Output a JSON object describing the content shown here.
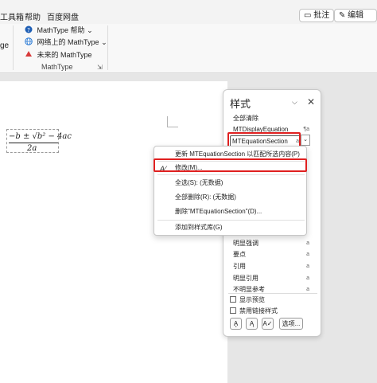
{
  "menubar": {
    "items": [
      "工具箱",
      "帮助",
      "百度网盘"
    ],
    "comment_button": "批注",
    "edit_button": "编辑"
  },
  "ribbon": {
    "cut_text": "ge",
    "mathtype_items": [
      "MathType 帮助",
      "网络上的 MathType",
      "未来的 MathType"
    ],
    "group_label": "MathType",
    "icon_colors": {
      "help": "#1f5fb5",
      "web": "#2b7bd6",
      "future": "#d83b3b"
    }
  },
  "document": {
    "equation_numerator": "−b ± √b² − 4ac",
    "equation_denominator": "2a"
  },
  "styles_pane": {
    "title": "样式",
    "entries": {
      "clear_all": "全部清除",
      "display_eq": "MTDisplayEquation",
      "display_eq_mark": "¶a",
      "selected": "MTEquationSection",
      "selected_mark": "a",
      "subtle_emphasis": "明显强调",
      "subtle_emphasis_mark": "a",
      "key_point": "要点",
      "key_point_mark": "a",
      "quote": "引用",
      "quote_mark": "a",
      "intense_quote": "明显引用",
      "intense_quote_mark": "a",
      "subtle_ref": "不明显参考",
      "subtle_ref_mark": "a"
    },
    "show_preview": "显示预览",
    "disable_linked": "禁用链接样式",
    "options_button": "选项..."
  },
  "context_menu": {
    "items": [
      "更新 MTEquationSection 以匹配所选内容(P)",
      "修改(M)...",
      "全选(S): (无数据)",
      "全部删除(R): (无数据)",
      "删除\"MTEquationSection\"(D)...",
      "添加到样式库(G)"
    ]
  }
}
